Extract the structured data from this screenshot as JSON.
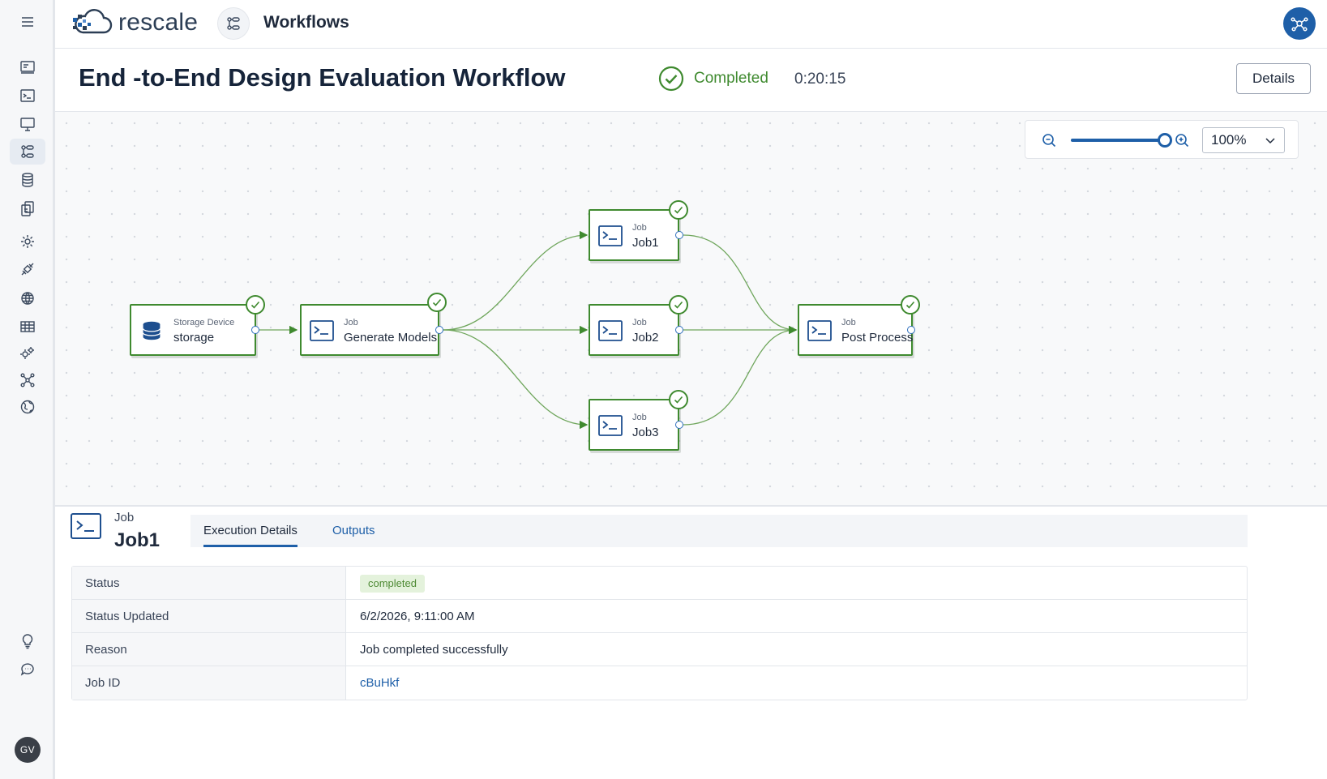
{
  "app": {
    "brand": "rescale",
    "section": "Workflows",
    "user_initials": "GV"
  },
  "header": {
    "title": "End -to-End Design Evaluation Workflow",
    "status": "Completed",
    "duration": "0:20:15",
    "details_label": "Details"
  },
  "zoom": {
    "level": "100%",
    "slider_fraction": 1.0
  },
  "nodes": {
    "storage": {
      "type": "Storage Device",
      "name": "storage"
    },
    "generate": {
      "type": "Job",
      "name": "Generate Models"
    },
    "job1": {
      "type": "Job",
      "name": "Job1"
    },
    "job2": {
      "type": "Job",
      "name": "Job2"
    },
    "job3": {
      "type": "Job",
      "name": "Job3"
    },
    "post": {
      "type": "Job",
      "name": "Post Process"
    }
  },
  "panel": {
    "type": "Job",
    "name": "Job1",
    "tabs": {
      "execution": "Execution Details",
      "outputs": "Outputs"
    },
    "rows": {
      "status_label": "Status",
      "status_value": "completed",
      "updated_label": "Status Updated",
      "updated_value": "6/2/2026, 9:11:00 AM",
      "reason_label": "Reason",
      "reason_value": "Job completed successfully",
      "id_label": "Job ID",
      "id_value": "cBuHkf"
    }
  },
  "colors": {
    "accent": "#1e5fa8",
    "success": "#3f8a2f",
    "badge_bg": "#e4f2dc"
  },
  "icons": {
    "sidebar": [
      "menu-icon",
      "dashboard-icon",
      "terminal-icon",
      "monitor-icon",
      "workflow-icon",
      "database-icon",
      "documents-icon",
      "settings-icon",
      "satellite-icon",
      "globe-grid-icon",
      "table-icon",
      "gears-icon",
      "network-icon",
      "world-icon",
      "lightbulb-icon",
      "chat-icon"
    ]
  }
}
